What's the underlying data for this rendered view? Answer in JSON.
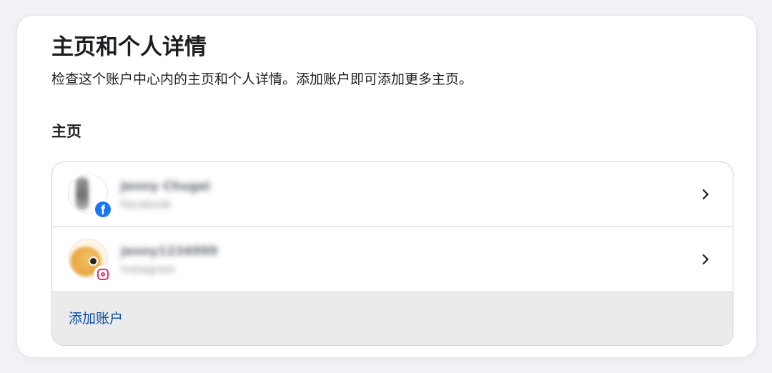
{
  "header": {
    "title": "主页和个人详情",
    "description": "检查这个账户中心内的主页和个人详情。添加账户即可添加更多主页。"
  },
  "section": {
    "title": "主页"
  },
  "accounts": [
    {
      "name": "Jenny Chugai",
      "platform": "Facebook",
      "platform_icon": "facebook-icon",
      "brand_color": "#1877f2"
    },
    {
      "name": "jenny1234999",
      "platform": "Instagram",
      "platform_icon": "instagram-icon",
      "brand_color": "#e1306c"
    }
  ],
  "add_account": {
    "label": "添加账户",
    "color": "#0a4da8"
  },
  "icons": {
    "chevron": "chevron-right-icon",
    "facebook_glyph": "f"
  }
}
